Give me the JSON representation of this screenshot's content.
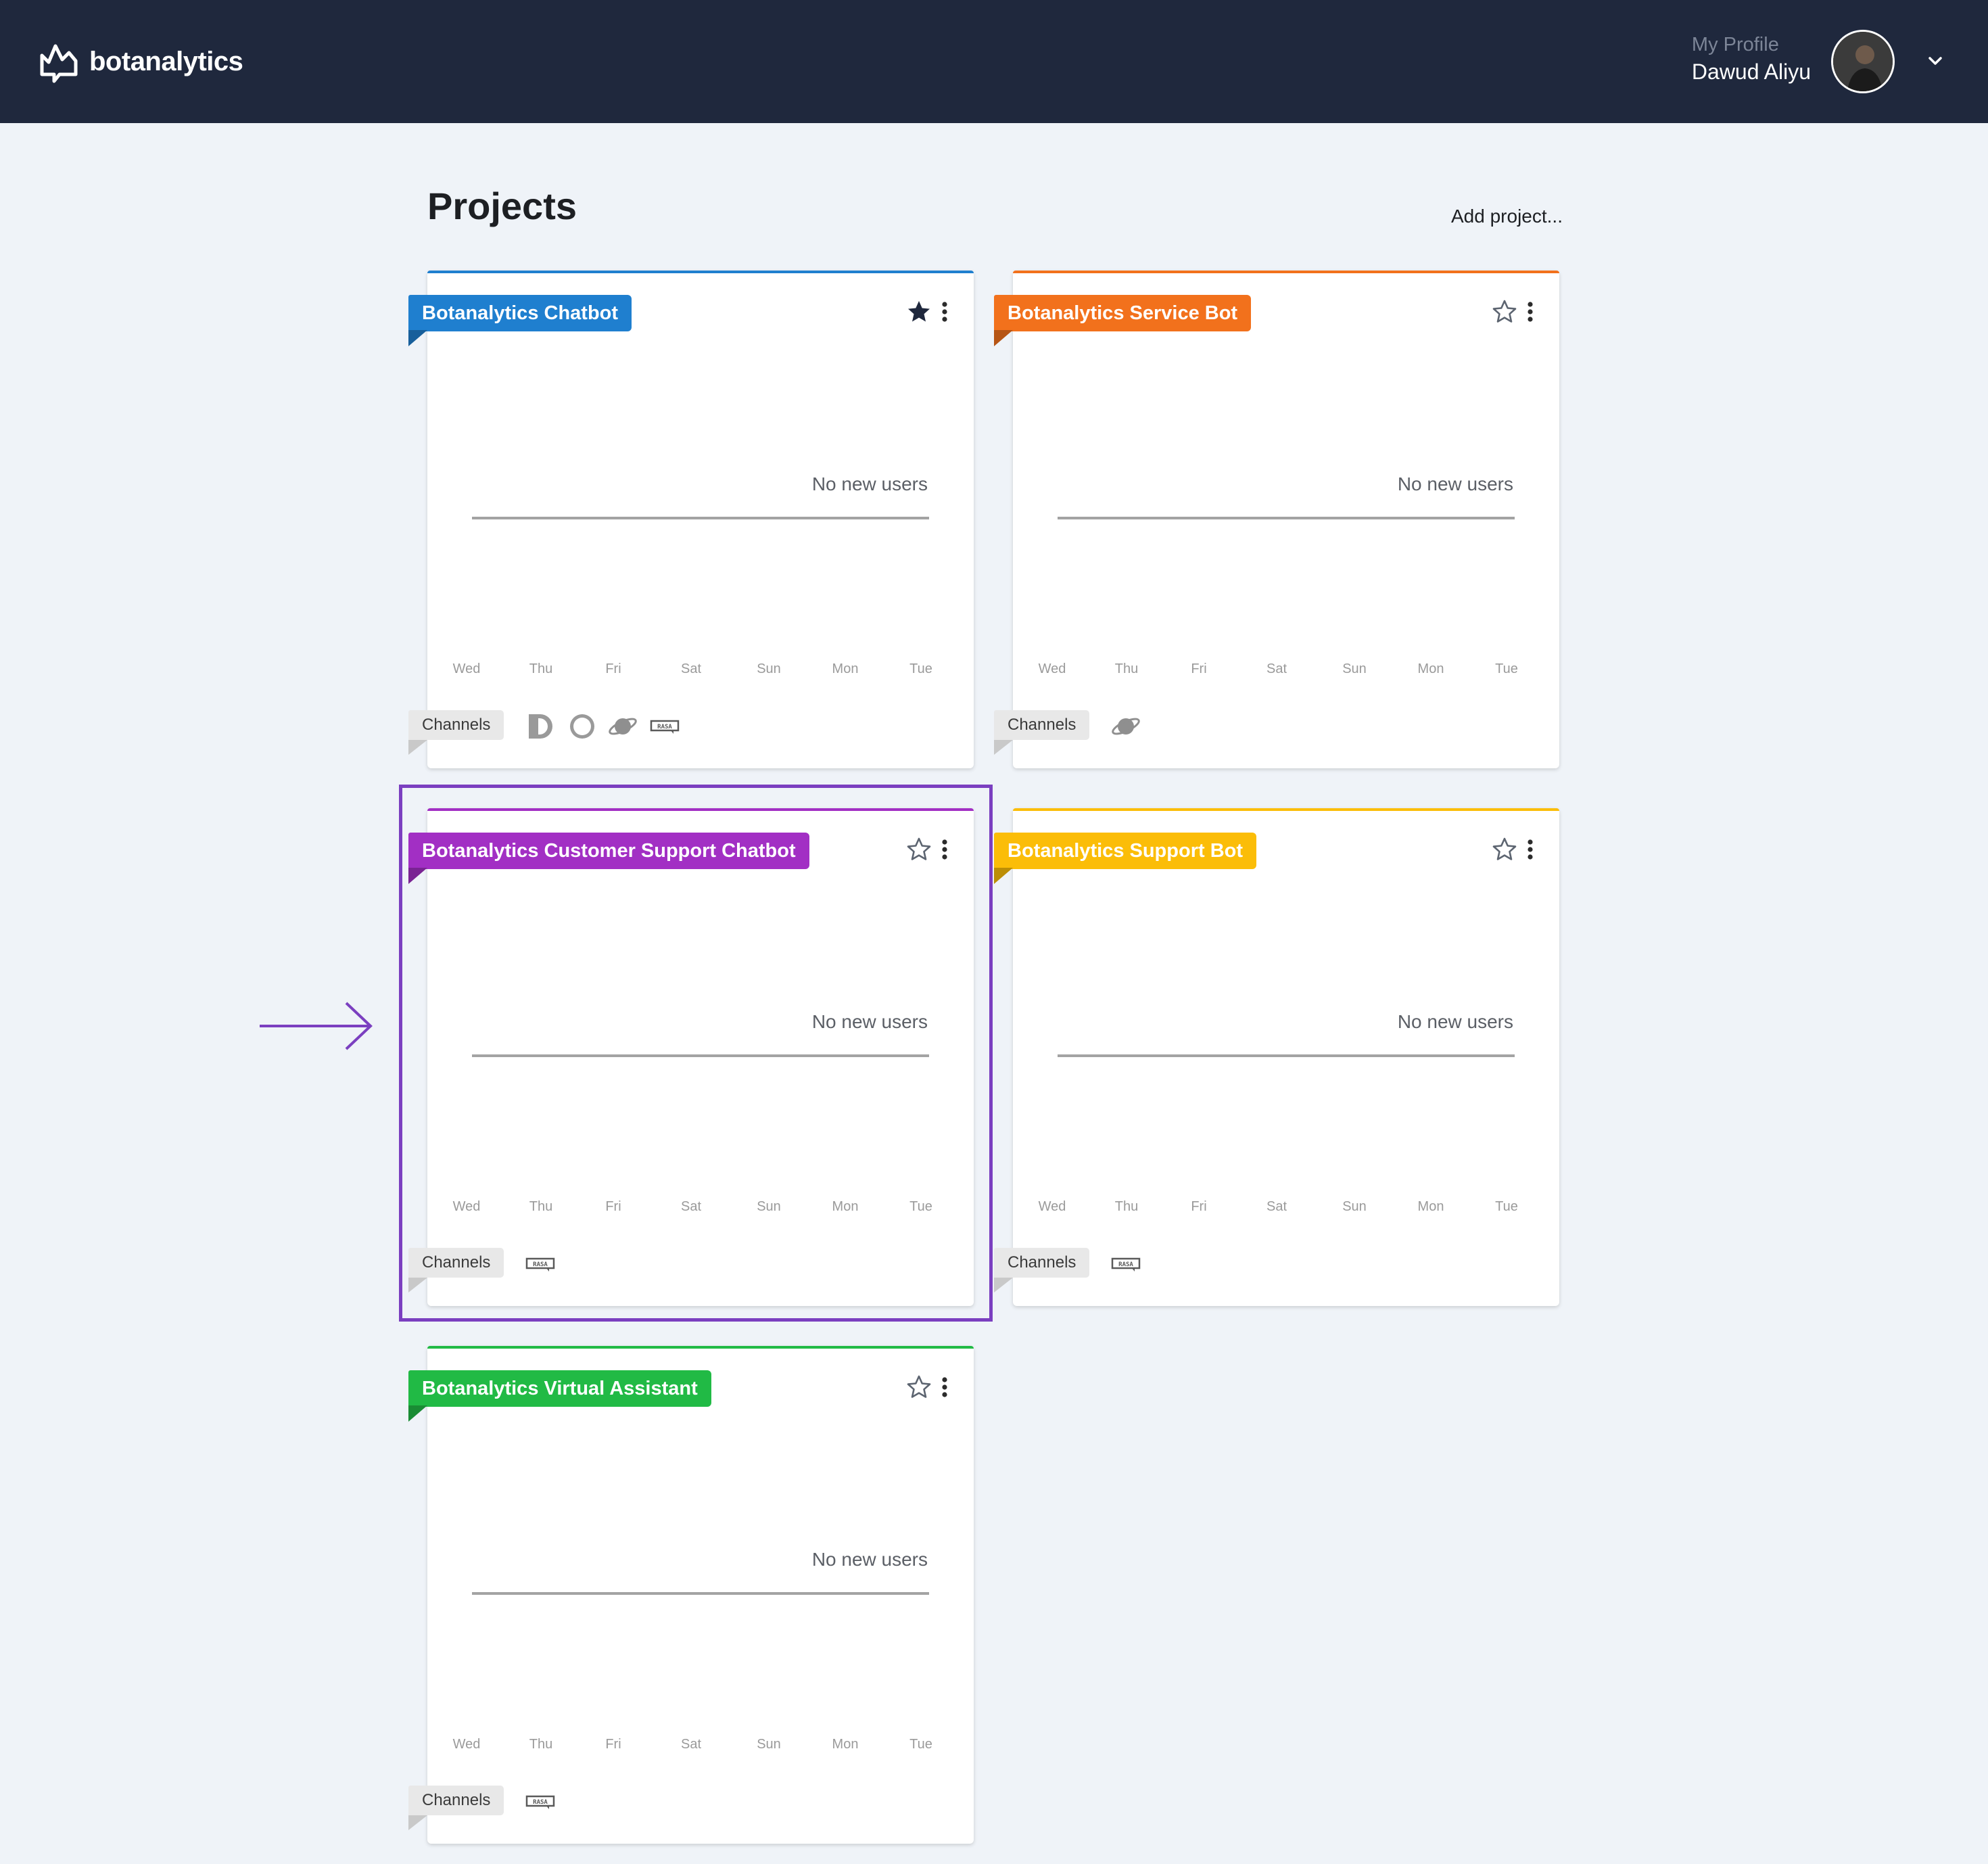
{
  "app": {
    "brand": "botanalytics",
    "profile_caption": "My Profile",
    "user_name": "Dawud Aliyu"
  },
  "page": {
    "title": "Projects",
    "add_project": "Add project..."
  },
  "days": [
    "Wed",
    "Thu",
    "Fri",
    "Sat",
    "Sun",
    "Mon",
    "Tue"
  ],
  "projects": [
    {
      "name": "Botanalytics Chatbot",
      "color": "#1f7fcf",
      "starred": true,
      "empty_label": "No new users",
      "channels_label": "Channels",
      "channels": [
        "bixby-icon",
        "alexa-icon",
        "saturn-icon",
        "rasa-icon"
      ]
    },
    {
      "name": "Botanalytics Service Bot",
      "color": "#f2711c",
      "starred": false,
      "empty_label": "No new users",
      "channels_label": "Channels",
      "channels": [
        "saturn-icon"
      ]
    },
    {
      "name": "Botanalytics Customer Support Chatbot",
      "color": "#a22fc4",
      "starred": false,
      "empty_label": "No new users",
      "channels_label": "Channels",
      "channels": [
        "rasa-icon"
      ]
    },
    {
      "name": "Botanalytics Support Bot",
      "color": "#fbbd08",
      "starred": false,
      "empty_label": "No new users",
      "channels_label": "Channels",
      "channels": [
        "rasa-icon"
      ]
    },
    {
      "name": "Botanalytics Virtual Assistant",
      "color": "#21ba45",
      "starred": false,
      "empty_label": "No new users",
      "channels_label": "Channels",
      "channels": [
        "rasa-icon"
      ]
    }
  ],
  "annotation": {
    "highlight_color": "#7b3fc0"
  }
}
